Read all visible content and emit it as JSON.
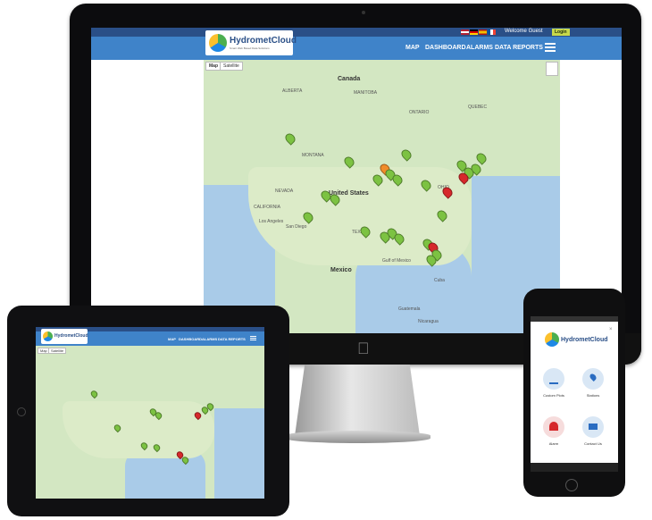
{
  "app": {
    "logo_text": "HydrometCloud",
    "logo_tagline": "Smart Web Based Data Solutions",
    "welcome_text": "Welcome Guest",
    "login_label": "Login"
  },
  "nav": {
    "items": [
      "MAP",
      "DASHBOARD",
      "ALARMS",
      "DATA REPORTS"
    ]
  },
  "map": {
    "toggle": [
      "Map",
      "Satellite"
    ],
    "labels": {
      "canada": "Canada",
      "alberta": "ALBERTA",
      "manitoba": "MANITOBA",
      "ontario": "ONTARIO",
      "quebec": "QUEBEC",
      "usa": "United States",
      "mexico": "Mexico",
      "cuba": "Cuba",
      "guatemala": "Guatemala",
      "nicaragua": "Nicaragua",
      "gulf": "Gulf of Mexico",
      "montana": "MONTANA",
      "nevada": "NEVADA",
      "california": "CALIFORNIA",
      "texas": "TEXAS",
      "ohio": "OHIO",
      "los_angeles": "Los Angeles",
      "san_diego": "San Diego"
    }
  },
  "phone": {
    "logo_text": "HydrometCloud",
    "menu": [
      "Custom Plots",
      "Stations",
      "Alarm",
      "Contact Us"
    ]
  },
  "colors": {
    "header_dark": "#2a4f87",
    "nav_blue": "#3f83c9",
    "pin_green": "#7cc242",
    "pin_red": "#d6282b",
    "pin_orange": "#f08c2a",
    "login_btn": "#c8d94a"
  }
}
